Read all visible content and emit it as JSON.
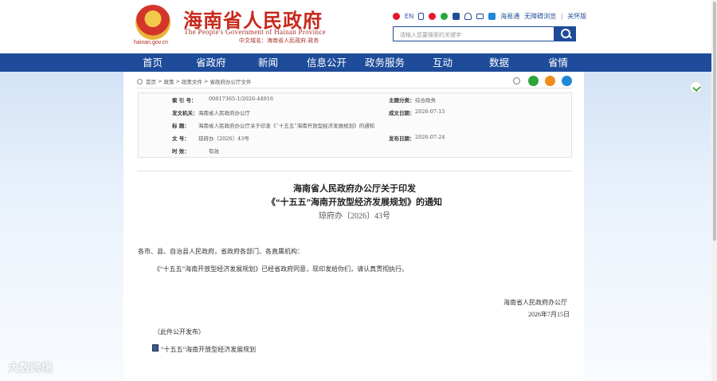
{
  "header": {
    "title_cn": "海南省人民政府",
    "title_en": "The People's Government of Hainan Province",
    "title_url": "中文域名：海南省人民政府.政务",
    "emblem_caption": "hainan.gov.cn",
    "toolbar": {
      "lang_en": "EN",
      "app_label": "海易通",
      "accessibility": "无障碍浏览",
      "care_mode": "关怀版",
      "separator": "|"
    },
    "search": {
      "placeholder": "请输入您要搜索的关键字"
    }
  },
  "nav": {
    "items": [
      {
        "label": "首页"
      },
      {
        "label": "省政府"
      },
      {
        "label": "新闻"
      },
      {
        "label": "信息公开"
      },
      {
        "label": "政务服务"
      },
      {
        "label": "互动"
      },
      {
        "label": "数据"
      },
      {
        "label": "省情"
      }
    ]
  },
  "breadcrumb": {
    "items": [
      "首页",
      "政策",
      "政策文件",
      "省政府办公厅文件"
    ],
    "separator": ">"
  },
  "info": {
    "index_label": "索  引  号：",
    "index_value": "00817365-1/2026-44916",
    "topic_label": "主题分类：",
    "topic_value": "综合政务",
    "issuer_label": "发文机关：",
    "issuer_value": "海南省人民政府办公厅",
    "date_label": "成文日期：",
    "date_value": "2026-07-15",
    "title_label": "标      题：",
    "title_value": "海南省人民政府办公厅关于印发《“十五五”海南开放型经济发展规划》的通知",
    "docno_label": "文      号：",
    "docno_value": "琼府办〔2026〕43号",
    "pubdate_label": "发布日期：",
    "pubdate_value": "2026-07-24",
    "validity_label": "时      效：",
    "validity_value": "有效"
  },
  "doc": {
    "title_line1": "海南省人民政府办公厅关于印发",
    "title_line2": "《“十五五”海南开放型经济发展规划》的通知",
    "doc_number": "琼府办〔2026〕43号",
    "salutation": "各市、县、自治县人民政府，省政府各部门、各直属机构：",
    "paragraph": "《“十五五”海南开放型经济发展规划》已经省政府同意，现印发给你们，请认真贯彻执行。",
    "signer": "海南省人民政府办公厅",
    "sign_date": "2026年7月15日",
    "disclosure": "（此件公开发布）",
    "attachment": "“十五五”海南开放型经济发展规划"
  },
  "watermark": "大数跨境",
  "colors": {
    "brand_red": "#c8281c",
    "nav_blue": "#1e4c9a",
    "wechat_green": "#2aa53a",
    "weibo_red": "#e6162d"
  },
  "icons": [
    "weibo-icon",
    "mobile-icon",
    "wechat-icon",
    "douyin-icon",
    "user-icon",
    "mail-icon",
    "app-icon",
    "search-icon",
    "home-icon",
    "share-icon",
    "qq-icon",
    "qzone-icon"
  ]
}
